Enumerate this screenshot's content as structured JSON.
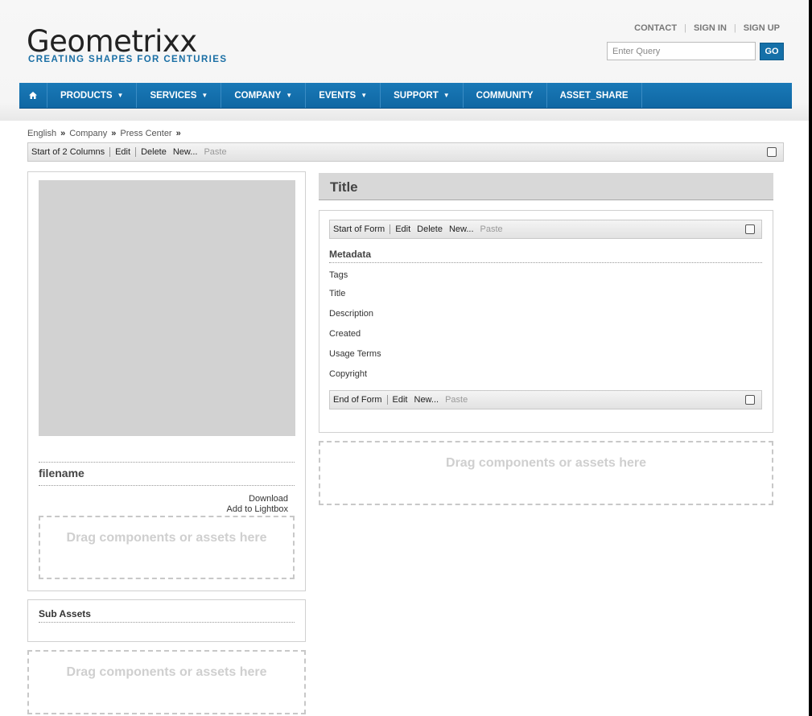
{
  "header": {
    "logo": "Geometrixx",
    "tagline": "CREATING SHAPES FOR CENTURIES",
    "links": {
      "contact": "CONTACT",
      "signin": "SIGN IN",
      "signup": "SIGN UP"
    },
    "search_placeholder": "Enter Query",
    "go_label": "GO"
  },
  "nav": {
    "home_icon": "home-icon",
    "items": [
      "PRODUCTS",
      "SERVICES",
      "COMPANY",
      "EVENTS",
      "SUPPORT",
      "COMMUNITY",
      "ASSET_SHARE"
    ],
    "caret": "▼"
  },
  "breadcrumb": [
    "English",
    "Company",
    "Press Center"
  ],
  "breadcrumb_sep": "»",
  "columns_bar": {
    "label": "Start of 2 Columns",
    "edit": "Edit",
    "delete": "Delete",
    "new": "New...",
    "paste": "Paste"
  },
  "left": {
    "filename": "filename",
    "download": "Download",
    "add_to_lightbox": "Add to Lightbox",
    "drop_text": "Drag components or assets here",
    "sub_assets": "Sub Assets",
    "drop_text_2": "Drag components or assets here"
  },
  "right": {
    "title": "Title",
    "form_start": {
      "label": "Start of Form",
      "edit": "Edit",
      "delete": "Delete",
      "new": "New...",
      "paste": "Paste"
    },
    "metadata_heading": "Metadata",
    "fields": [
      "Tags",
      "Title",
      "Description",
      "Created",
      "Usage Terms",
      "Copyright"
    ],
    "form_end": {
      "label": "End of Form",
      "edit": "Edit",
      "new": "New...",
      "paste": "Paste"
    },
    "drop_text": "Drag components or assets here"
  },
  "colors": {
    "accent": "#1570a8",
    "nav": "#1a79b7",
    "placeholder_gray": "#d2d2d2"
  }
}
